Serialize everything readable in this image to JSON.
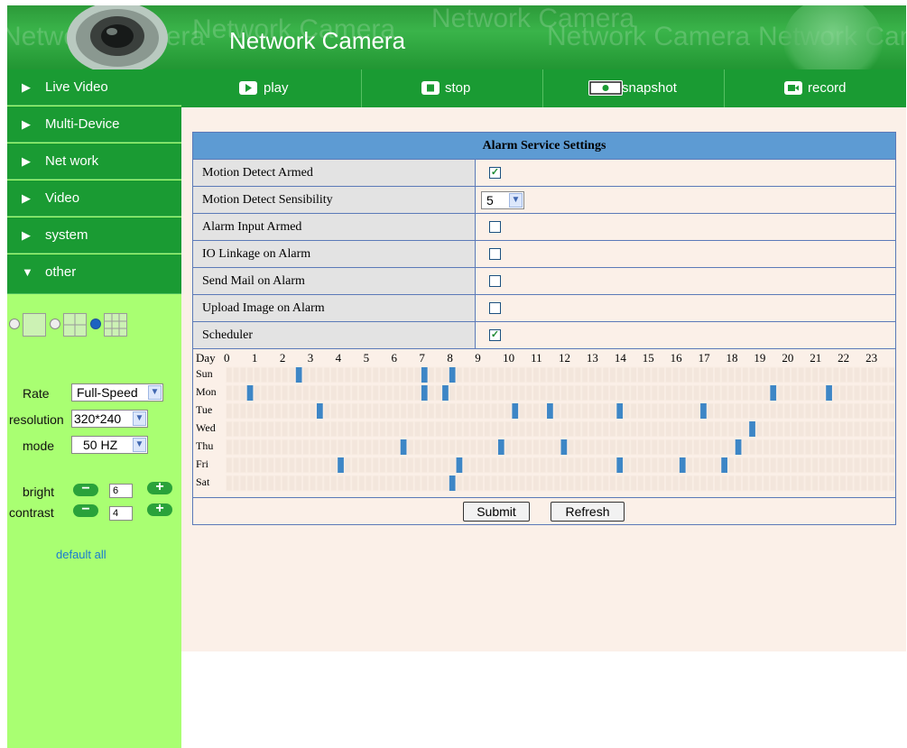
{
  "header": {
    "title": "Network Camera",
    "watermark": "Network Camera"
  },
  "nav": [
    {
      "label": "Live Video",
      "arrow": "▶"
    },
    {
      "label": "Multi-Device",
      "arrow": "▶"
    },
    {
      "label": "Net work",
      "arrow": "▶"
    },
    {
      "label": "Video",
      "arrow": "▶"
    },
    {
      "label": "system",
      "arrow": "▶"
    },
    {
      "label": "other",
      "arrow": "▼"
    }
  ],
  "toolbar": {
    "play": "play",
    "stop": "stop",
    "snapshot": "snapshot",
    "record": "record"
  },
  "controls": {
    "rate_label": "Rate",
    "rate_value": "Full-Speed",
    "resolution_label": "resolution",
    "resolution_value": "320*240",
    "mode_label": "mode",
    "mode_value": "50 HZ",
    "bright_label": "bright",
    "bright_value": "6",
    "contrast_label": "contrast",
    "contrast_value": "4",
    "default_all": "default all",
    "selected_layout": 3
  },
  "form": {
    "title": "Alarm Service Settings",
    "rows": [
      {
        "label": "Motion Detect Armed",
        "type": "checkbox",
        "checked": true
      },
      {
        "label": "Motion Detect Sensibility",
        "type": "select",
        "value": "5"
      },
      {
        "label": "Alarm Input Armed",
        "type": "checkbox",
        "checked": false
      },
      {
        "label": "IO Linkage on Alarm",
        "type": "checkbox",
        "checked": false
      },
      {
        "label": "Send Mail on Alarm",
        "type": "checkbox",
        "checked": false
      },
      {
        "label": "Upload Image on Alarm",
        "type": "checkbox",
        "checked": false
      },
      {
        "label": "Scheduler",
        "type": "checkbox",
        "checked": true
      }
    ],
    "submit": "Submit",
    "refresh": "Refresh"
  },
  "scheduler": {
    "day_header": "Day",
    "hours": [
      "0",
      "1",
      "2",
      "3",
      "4",
      "5",
      "6",
      "7",
      "8",
      "9",
      "10",
      "11",
      "12",
      "13",
      "14",
      "15",
      "16",
      "17",
      "18",
      "19",
      "20",
      "21",
      "22",
      "23"
    ],
    "days": [
      "Sun",
      "Mon",
      "Tue",
      "Wed",
      "Thu",
      "Fri",
      "Sat"
    ],
    "slots_per_hour": 4,
    "active": {
      "Sun": [
        10,
        28,
        32
      ],
      "Mon": [
        3,
        28,
        31,
        78,
        86
      ],
      "Tue": [
        13,
        41,
        46,
        56,
        68
      ],
      "Wed": [
        75
      ],
      "Thu": [
        25,
        39,
        48,
        73
      ],
      "Fri": [
        16,
        33,
        56,
        65,
        71
      ],
      "Sat": [
        32
      ]
    }
  },
  "colors": {
    "header_green": "#2c9a39",
    "nav_green": "#1a9b33",
    "sidebar_bg": "#a9ff72",
    "content_bg": "#fbf0e8",
    "table_header": "#5d9bd3",
    "slot_active": "#3d86c6"
  }
}
